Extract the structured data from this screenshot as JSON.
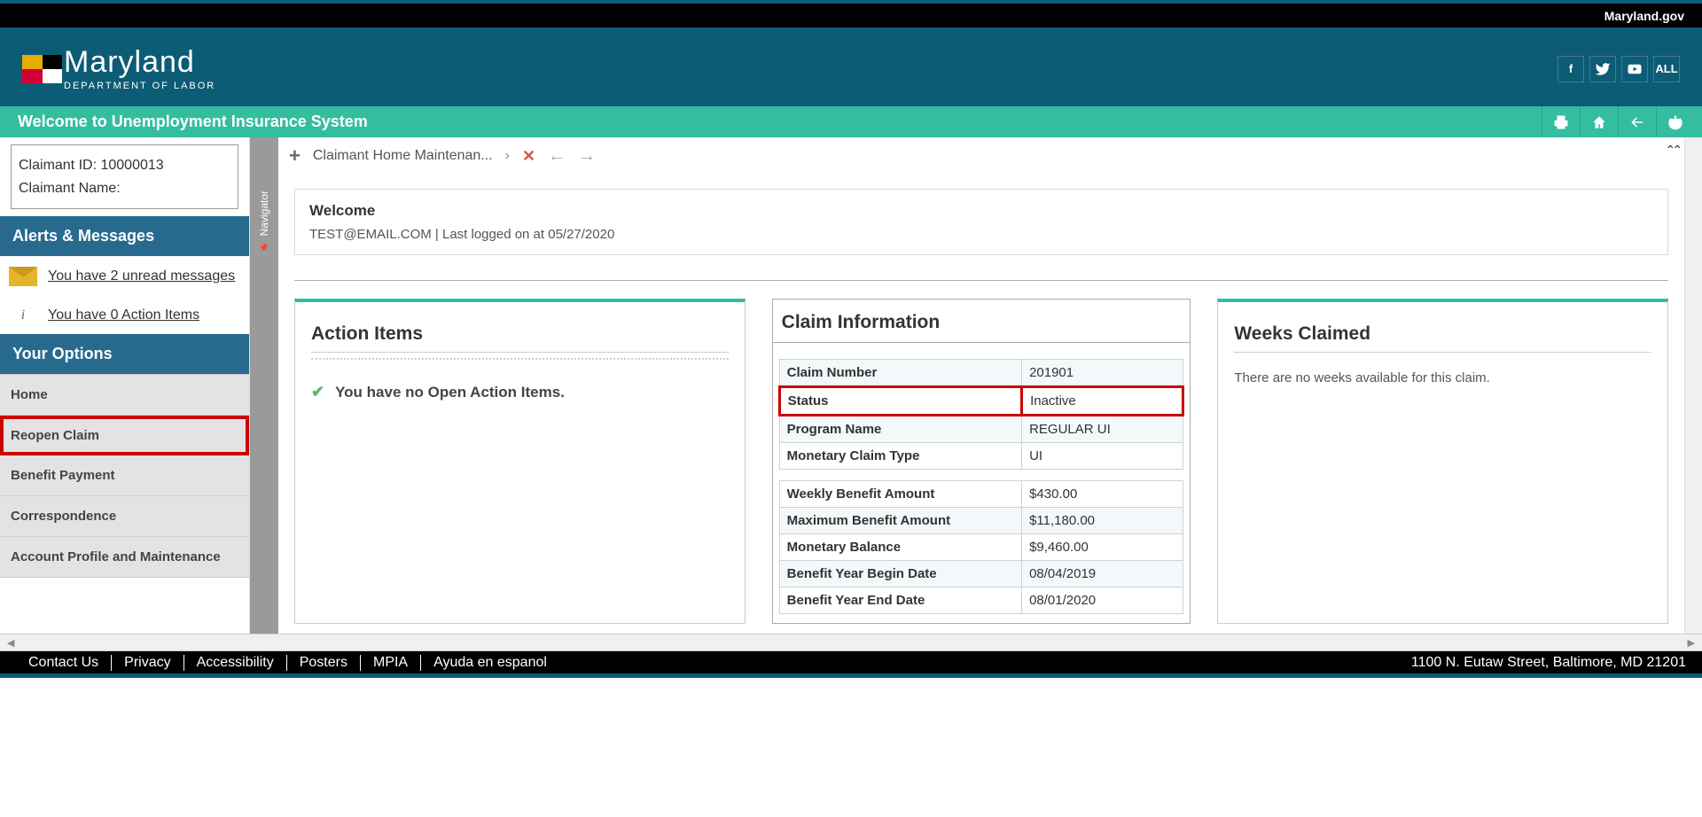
{
  "topbar": {
    "link": "Maryland.gov"
  },
  "logo": {
    "main": "Maryland",
    "sub": "DEPARTMENT OF LABOR"
  },
  "social": {
    "f": "f",
    "t": "t",
    "y": "Y",
    "all": "ALL"
  },
  "greenbar": {
    "title": "Welcome to Unemployment Insurance System"
  },
  "claimant": {
    "id_label": "Claimant ID: 10000013",
    "name_label": "Claimant Name:"
  },
  "sections": {
    "alerts": "Alerts & Messages",
    "options": "Your Options"
  },
  "alerts": {
    "unread": "You have 2 unread messages",
    "actions": "You have 0 Action Items"
  },
  "menu": {
    "home": "Home",
    "reopen": "Reopen Claim",
    "benefit": "Benefit Payment",
    "corr": "Correspondence",
    "profile": "Account Profile and Maintenance"
  },
  "navigator": "Navigator",
  "breadcrumb": {
    "page": "Claimant Home Maintenan..."
  },
  "welcome": {
    "title": "Welcome",
    "text": "TEST@EMAIL.COM | Last logged on at 05/27/2020"
  },
  "actionItems": {
    "title": "Action Items",
    "empty": "You have no Open Action Items."
  },
  "claimInfo": {
    "title": "Claim Information",
    "rows": {
      "claim_num_l": "Claim Number",
      "claim_num_v": "201901",
      "status_l": "Status",
      "status_v": "Inactive",
      "program_l": "Program Name",
      "program_v": "REGULAR UI",
      "mtype_l": "Monetary Claim Type",
      "mtype_v": "UI",
      "wba_l": "Weekly Benefit Amount",
      "wba_v": "$430.00",
      "mba_l": "Maximum Benefit Amount",
      "mba_v": "$11,180.00",
      "bal_l": "Monetary Balance",
      "bal_v": "$9,460.00",
      "begin_l": "Benefit Year Begin Date",
      "begin_v": "08/04/2019",
      "end_l": "Benefit Year End Date",
      "end_v": "08/01/2020"
    }
  },
  "weeks": {
    "title": "Weeks Claimed",
    "msg": "There are no weeks available for this claim."
  },
  "footer": {
    "links": [
      "Contact Us",
      "Privacy",
      "Accessibility",
      "Posters",
      "MPIA",
      "Ayuda en espanol"
    ],
    "address": "1100 N. Eutaw Street, Baltimore, MD 21201"
  }
}
